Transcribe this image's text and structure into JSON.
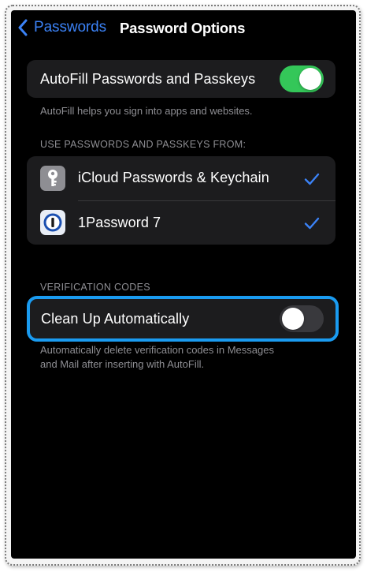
{
  "nav": {
    "back_label": "Passwords",
    "title": "Password Options"
  },
  "autofill": {
    "label": "AutoFill Passwords and Passkeys",
    "enabled": true,
    "footnote": "AutoFill helps you sign into apps and websites."
  },
  "sources": {
    "header": "USE PASSWORDS AND PASSKEYS FROM:",
    "items": [
      {
        "label": "iCloud Passwords & Keychain",
        "icon": "key-icon",
        "checked": true
      },
      {
        "label": "1Password 7",
        "icon": "1password-icon",
        "checked": true
      }
    ]
  },
  "verification": {
    "header": "VERIFICATION CODES",
    "cleanup_label": "Clean Up Automatically",
    "cleanup_enabled": false,
    "footnote_line1": "Automatically delete verification codes in Messages",
    "footnote_line2": "and Mail after inserting with AutoFill."
  },
  "colors": {
    "accent": "#3b82f6",
    "toggle_on": "#34c759",
    "highlight": "#1a9bf0"
  }
}
